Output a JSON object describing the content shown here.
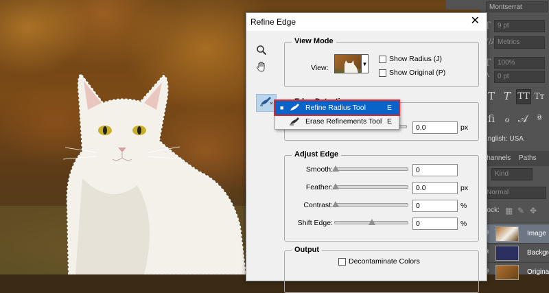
{
  "dialog": {
    "title": "Refine Edge",
    "close_glyph": "✕",
    "view_mode": {
      "title": "View Mode",
      "view_label": "View:",
      "show_radius": "Show Radius (J)",
      "show_original": "Show Original (P)",
      "show_radius_checked": false,
      "show_original_checked": false
    },
    "edge_detection": {
      "title": "Edge Detection",
      "radius_value": "0.0",
      "radius_unit": "px"
    },
    "adjust_edge": {
      "title": "Adjust Edge",
      "smooth_label": "Smooth:",
      "smooth_value": "0",
      "feather_label": "Feather:",
      "feather_value": "0.0",
      "feather_unit": "px",
      "contrast_label": "Contrast:",
      "contrast_value": "0",
      "contrast_unit": "%",
      "shift_label": "Shift Edge:",
      "shift_value": "0",
      "shift_unit": "%"
    },
    "output": {
      "title": "Output",
      "decontaminate": "Decontaminate Colors",
      "decontaminate_checked": false
    }
  },
  "tool_menu": {
    "items": [
      {
        "label": "Refine Radius Tool",
        "key": "E",
        "selected": true,
        "bullet": "■"
      },
      {
        "label": "Erase Refinements Tool",
        "key": "E",
        "selected": false,
        "bullet": ""
      }
    ]
  },
  "ps_panel": {
    "font_family": "Montserrat",
    "size": "9 pt",
    "kerning": "Metrics",
    "scale": "100%",
    "baseline": "0 pt",
    "language": "English: USA",
    "tabs": [
      "Channels",
      "Paths"
    ],
    "filter": "Kind",
    "blend": "Normal",
    "lock_label": "Lock:",
    "layers": [
      {
        "name": "Image",
        "selected": true
      },
      {
        "name": "Background",
        "selected": false
      },
      {
        "name": "Original",
        "selected": false
      }
    ]
  },
  "colors": {
    "menu_highlight": "#0a63c9",
    "menu_outline": "#e0242b",
    "selected_tool_bg": "#b9d5ee"
  }
}
